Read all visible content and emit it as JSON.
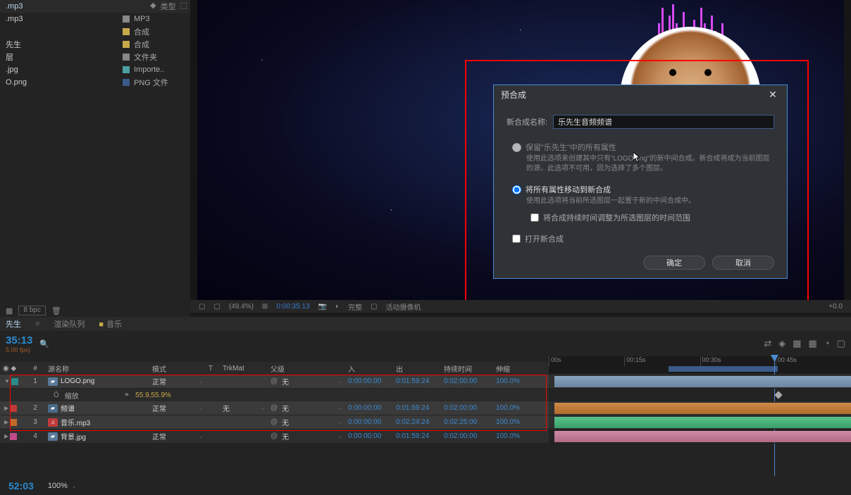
{
  "project": {
    "header_filename": ".mp3",
    "header_type_label": "类型",
    "items": [
      {
        "name": ".mp3",
        "type": "MP3",
        "swatch": "sw-gray"
      },
      {
        "name": "",
        "type": "合成",
        "swatch": "sw-yellow"
      },
      {
        "name": "先生",
        "type": "合成",
        "swatch": "sw-yellow"
      },
      {
        "name": "层",
        "type": "文件夹",
        "swatch": "sw-gray"
      },
      {
        "name": ".jpg",
        "type": "Importe..",
        "swatch": "sw-cyan"
      },
      {
        "name": "O.png",
        "type": "PNG 文件",
        "swatch": "sw-blue"
      }
    ],
    "footer_bpc": "8 bpc"
  },
  "preview_toolbar": {
    "zoom": "(49.4%)",
    "timecode": "0:00:35:13",
    "fit": "完整",
    "camera": "活动摄像机",
    "exposure": "+0.0"
  },
  "dialog": {
    "title": "预合成",
    "name_label": "新合成名称:",
    "name_value": "乐先生音频频谱",
    "radio1_label": "保留\"乐先生\"中的所有属性",
    "radio1_desc": "使用此选项来创建其中只有\"LOGO.png\"的新中间合成。新合成将成为当前图层的源。此选项不可用，因为选择了多个图层。",
    "radio2_label": "将所有属性移动到新合成",
    "radio2_desc": "使用此选项将当前所选图层一起置于新的中间合成中。",
    "check1_label": "将合成持续时间调整为所选图层的时间范围",
    "check2_label": "打开新合成",
    "ok_label": "确定",
    "cancel_label": "取消"
  },
  "timeline": {
    "tabs": {
      "active": "先生",
      "tab2": "渲染队列",
      "tab3": "音乐"
    },
    "timecode": "35:13",
    "fps": "5.00 fps)",
    "ruler": [
      "00s",
      "00:15s",
      "00:30s",
      "00:45s"
    ],
    "headers": {
      "num": "#",
      "name": "源名称",
      "mode": "模式",
      "t": "T",
      "trk": "TrkMat",
      "parent": "父级",
      "in": "入",
      "out": "出",
      "dur": "持续时间",
      "stretch": "伸缩"
    },
    "layers": [
      {
        "num": "1",
        "name": "LOGO.png",
        "icon": "img",
        "sw": "sw-teal",
        "mode": "正常",
        "trk": "",
        "parent": "无",
        "in": "0:00:00:00",
        "out": "0:01:59:24",
        "dur": "0:02:00:00",
        "stretch": "100.0%",
        "sel": true
      },
      {
        "num": "2",
        "name": "频谱",
        "icon": "comp",
        "sw": "sw-red",
        "mode": "正常",
        "trk": "无",
        "parent": "无",
        "in": "0:00:00:00",
        "out": "0:01:59:24",
        "dur": "0:02:00:00",
        "stretch": "100.0%",
        "sel": true
      },
      {
        "num": "3",
        "name": "音乐.mp3",
        "icon": "audio",
        "sw": "sw-orange",
        "mode": "",
        "trk": "",
        "parent": "无",
        "in": "0:00:00:00",
        "out": "0:02:24:24",
        "dur": "0:02:25:00",
        "stretch": "100.0%",
        "sel": true
      },
      {
        "num": "4",
        "name": "背景.jpg",
        "icon": "img",
        "sw": "sw-pink",
        "mode": "正常",
        "trk": "",
        "parent": "无",
        "in": "0:00:00:00",
        "out": "0:01:59:24",
        "dur": "0:02:00:00",
        "stretch": "100.0%",
        "sel": false
      }
    ],
    "scale_row": {
      "label": "缩放",
      "value": "55.9,55.9%"
    }
  },
  "bottom": {
    "timecode": "52:03",
    "zoom": "100%"
  }
}
